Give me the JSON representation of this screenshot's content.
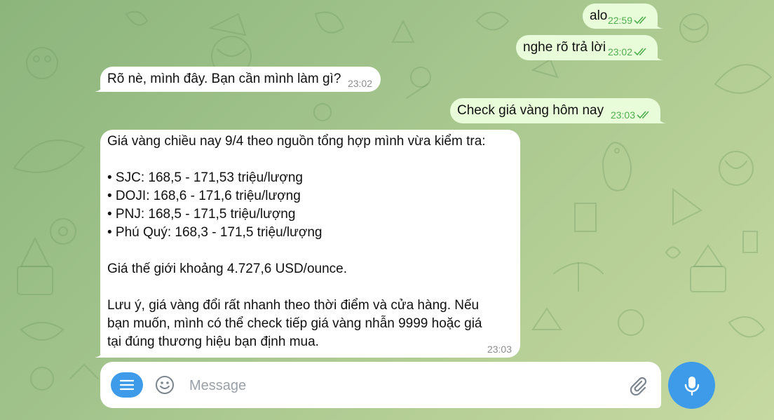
{
  "colors": {
    "outgoing_bubble": "#e8fcd9",
    "incoming_bubble": "#ffffff",
    "accent": "#3d9be9",
    "read_check": "#4fae4e",
    "timestamp_incoming": "#8d8d8d"
  },
  "messages": [
    {
      "direction": "out",
      "text": "alo",
      "time": "22:59",
      "status_icon": "double-check-icon"
    },
    {
      "direction": "out",
      "text": "nghe rõ trả lời",
      "time": "23:02",
      "status_icon": "double-check-icon"
    },
    {
      "direction": "in",
      "text": "Rõ nè, mình đây. Bạn cần mình làm gì?",
      "time": "23:02"
    },
    {
      "direction": "out",
      "text": "Check giá vàng hôm nay",
      "time": "23:03",
      "status_icon": "double-check-icon"
    },
    {
      "direction": "in",
      "intro": "Giá vàng chiều nay 9/4 theo nguồn tổng hợp mình vừa kiểm tra:",
      "bullets": [
        "• SJC: 168,5 - 171,53 triệu/lượng",
        "• DOJI: 168,6 - 171,6 triệu/lượng",
        "• PNJ: 168,5 - 171,5 triệu/lượng",
        "• Phú Quý: 168,3 - 171,5 triệu/lượng"
      ],
      "world": "Giá thế giới khoảng 4.727,6 USD/ounce.",
      "note_lines": [
        "Lưu ý, giá vàng đổi rất nhanh theo thời điểm và cửa hàng. Nếu",
        "bạn muốn, mình có thể check tiếp giá vàng nhẫn 9999 hoặc giá",
        "tại đúng thương hiệu bạn định mua."
      ],
      "time": "23:03"
    }
  ],
  "composer": {
    "placeholder": "Message",
    "menu_icon": "menu-icon",
    "emoji_icon": "smiley-icon",
    "attach_icon": "paperclip-icon",
    "send_icon": "microphone-icon"
  }
}
